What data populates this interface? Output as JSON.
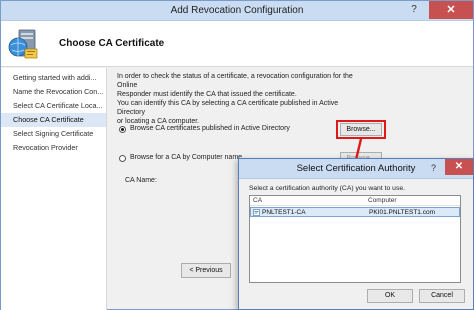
{
  "window": {
    "title": "Add Revocation Configuration",
    "help_glyph": "?",
    "close_glyph": "✕"
  },
  "header": {
    "title": "Choose CA Certificate"
  },
  "steps": [
    {
      "label": "Getting started with addi..."
    },
    {
      "label": "Name the Revocation Con..."
    },
    {
      "label": "Select CA Certificate Loca..."
    },
    {
      "label": "Choose CA Certificate",
      "active": true
    },
    {
      "label": "Select Signing Certificate"
    },
    {
      "label": "Revocation Provider"
    }
  ],
  "content": {
    "intro_line1": "In order to check the status of a certificate, a revocation configuration for the Online",
    "intro_line2": "Responder must identify the CA that issued the certificate.",
    "intro_line3": "You can identify this CA by selecting a CA certificate published in Active Directory",
    "intro_line4": "or locating a CA computer.",
    "option_ad_label": "Browse CA certificates published in Active Directory",
    "option_computer_label": "Browse for a CA by Computer name",
    "browse_button": "Browse...",
    "browse_button_2": "Browse...",
    "ca_name_label": "CA Name:",
    "previous_button": "< Previous"
  },
  "dialog": {
    "title": "Select Certification Authority",
    "help_glyph": "?",
    "close_glyph": "✕",
    "message": "Select a certification authority (CA) you want to use.",
    "columns": [
      "CA",
      "Computer"
    ],
    "rows": [
      {
        "ca": "PNLTEST1-CA",
        "computer": "PKI01.PNLTEST1.com"
      }
    ],
    "ok_button": "OK",
    "cancel_button": "Cancel"
  },
  "colors": {
    "highlight": "#e01818",
    "titlebar": "#c9dcf2",
    "selection": "#dce9f8"
  }
}
